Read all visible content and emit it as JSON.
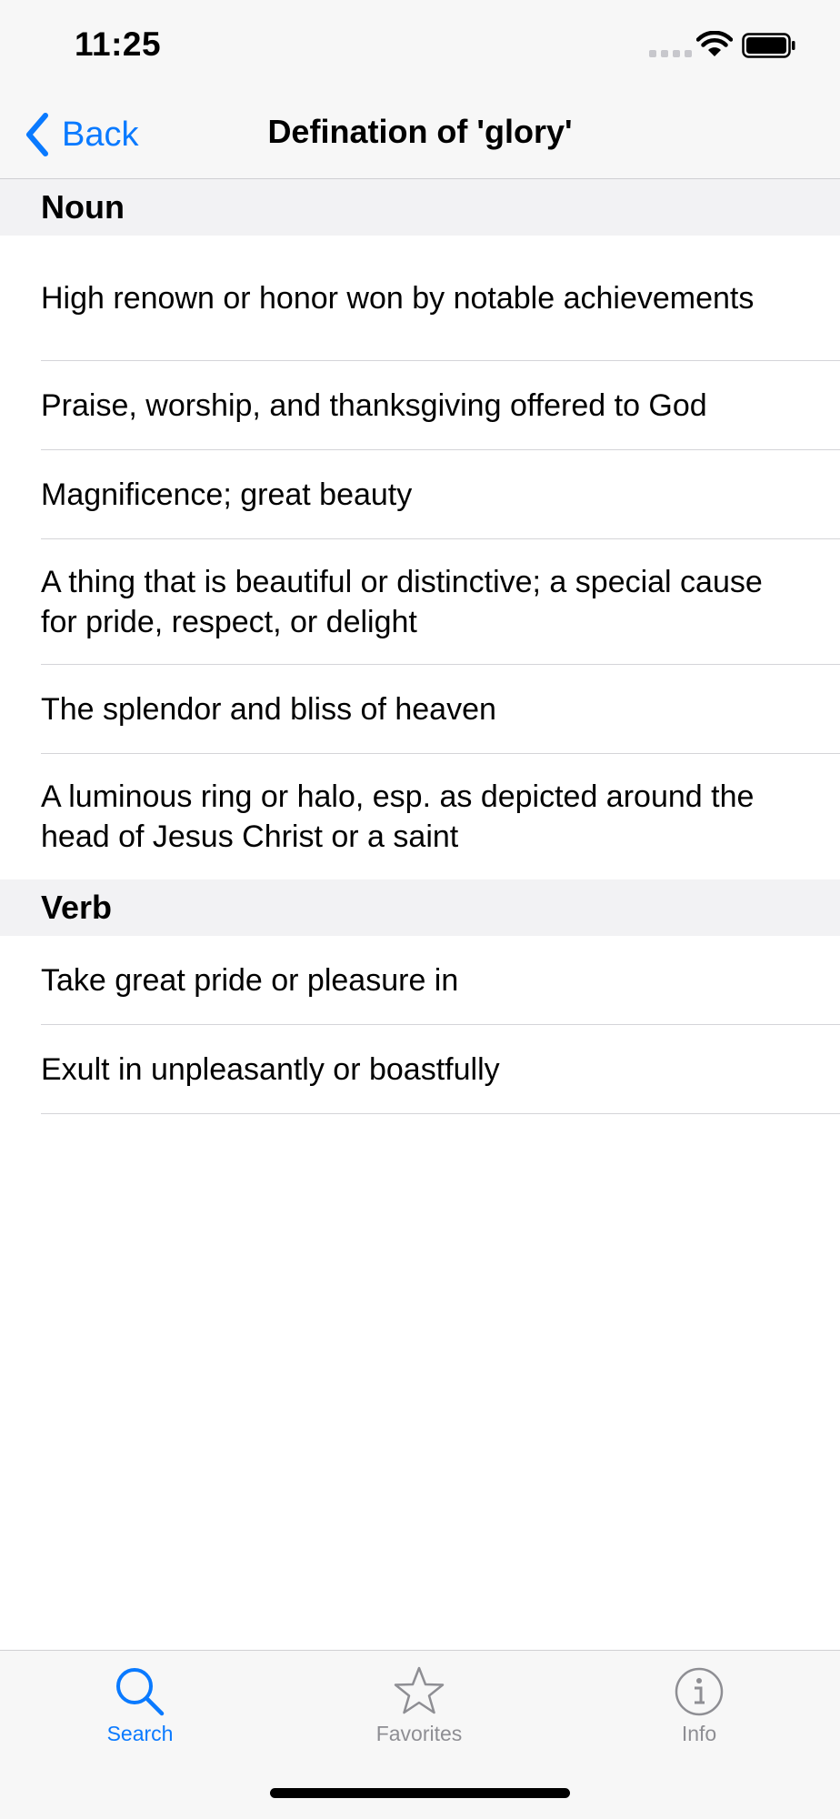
{
  "status_bar": {
    "time": "11:25"
  },
  "nav": {
    "back_label": "Back",
    "title": "Defination of 'glory'"
  },
  "sections": [
    {
      "header": "Noun",
      "rows": [
        "High renown or honor won by notable achievements",
        "Praise, worship, and thanksgiving offered to God",
        "Magnificence; great beauty",
        "A thing that is beautiful or distinctive; a special cause for pride, respect, or delight",
        "The splendor and bliss of heaven",
        "A luminous ring or halo, esp. as depicted around the head of Jesus Christ or a saint"
      ]
    },
    {
      "header": "Verb",
      "rows": [
        "Take great pride or pleasure in",
        "Exult in unpleasantly or boastfully"
      ]
    }
  ],
  "tab_bar": {
    "tabs": [
      {
        "label": "Search",
        "icon": "search-icon",
        "active": true
      },
      {
        "label": "Favorites",
        "icon": "star-icon",
        "active": false
      },
      {
        "label": "Info",
        "icon": "info-icon",
        "active": false
      }
    ]
  },
  "colors": {
    "accent": "#0a7aff",
    "inactive": "#8e8e93",
    "bar_background": "#f7f7f7",
    "section_background": "#f2f2f4"
  }
}
